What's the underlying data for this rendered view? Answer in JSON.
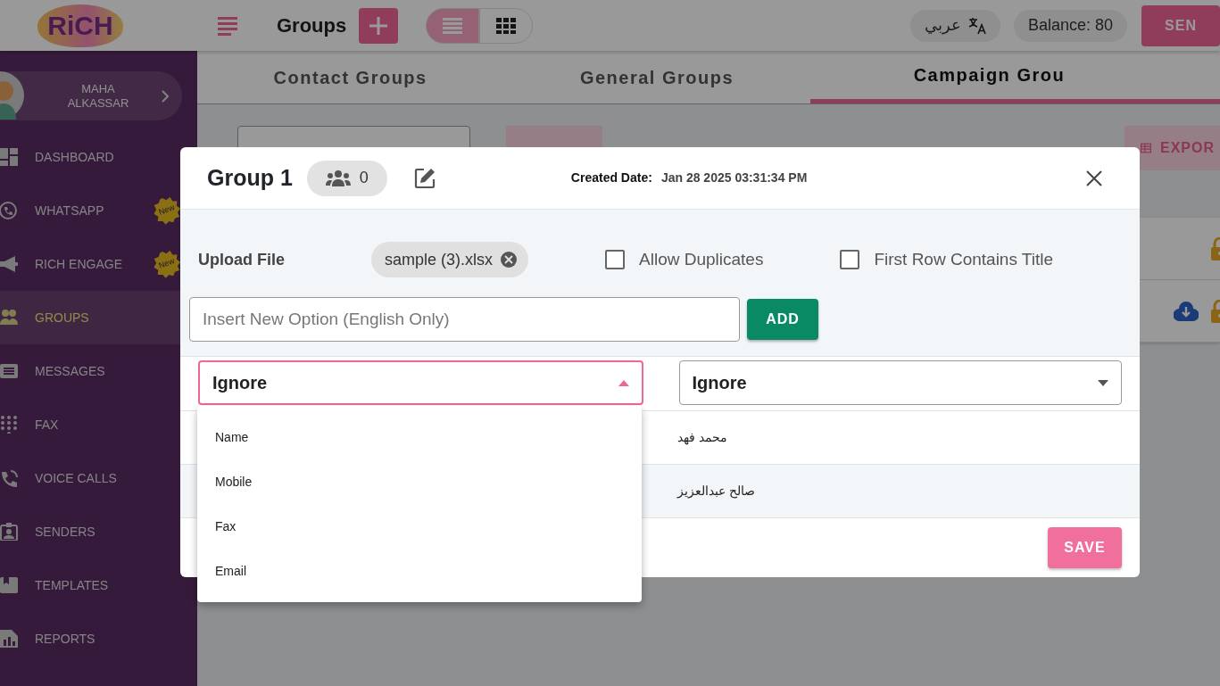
{
  "logo": {
    "text": "RiCH"
  },
  "topbar": {
    "title": "Groups",
    "view_modes": [
      {
        "kind": "list",
        "selected": true
      },
      {
        "kind": "grid",
        "selected": false
      }
    ],
    "language": "عربي",
    "balance": "Balance: 80",
    "send_button": "SEN"
  },
  "user": {
    "name": "MAHA ALKASSAR"
  },
  "sidebar": {
    "items": [
      {
        "label": "DASHBOARD",
        "selected": false
      },
      {
        "label": "WHATSAPP",
        "selected": false,
        "badge": "New"
      },
      {
        "label": "RICH ENGAGE",
        "selected": false,
        "badge": "New"
      },
      {
        "label": "GROUPS",
        "selected": true
      },
      {
        "label": "MESSAGES",
        "selected": false
      },
      {
        "label": "FAX",
        "selected": false
      },
      {
        "label": "VOICE CALLS",
        "selected": false
      },
      {
        "label": "SENDERS",
        "selected": false
      },
      {
        "label": "TEMPLATES",
        "selected": false
      },
      {
        "label": "REPORTS",
        "selected": false
      }
    ]
  },
  "tabs": [
    {
      "label": "Contact Groups",
      "selected": false
    },
    {
      "label": "General Groups",
      "selected": false
    },
    {
      "label": "Campaign Grou",
      "selected": true
    }
  ],
  "toolbar": {
    "export_button": "EXPOR"
  },
  "group_rows": [
    {
      "downloadable": false,
      "locked": true
    },
    {
      "downloadable": true,
      "locked": true
    }
  ],
  "modal": {
    "title": "Group 1",
    "member_count": "0",
    "created_label": "Created Date:",
    "created_value": "Jan 28 2025 03:31:34 PM",
    "upload_label": "Upload File",
    "file_chip": "sample (3).xlsx",
    "checkboxes": [
      {
        "label": "Allow Duplicates",
        "checked": false
      },
      {
        "label": "First Row Contains Title",
        "checked": false
      }
    ],
    "option_input": {
      "placeholder": "Insert New Option (English Only)"
    },
    "add_button": "ADD",
    "column_selects": [
      {
        "value": "Ignore",
        "expanded": true
      },
      {
        "value": "Ignore",
        "expanded": false
      }
    ],
    "rows": [
      {
        "column_2": "محمد فهد"
      },
      {
        "column_2": "صالح عبدالعزيز"
      }
    ],
    "dropdown_options": [
      "Name",
      "Mobile",
      "Fax",
      "Email"
    ],
    "save_button": "SAVE"
  }
}
